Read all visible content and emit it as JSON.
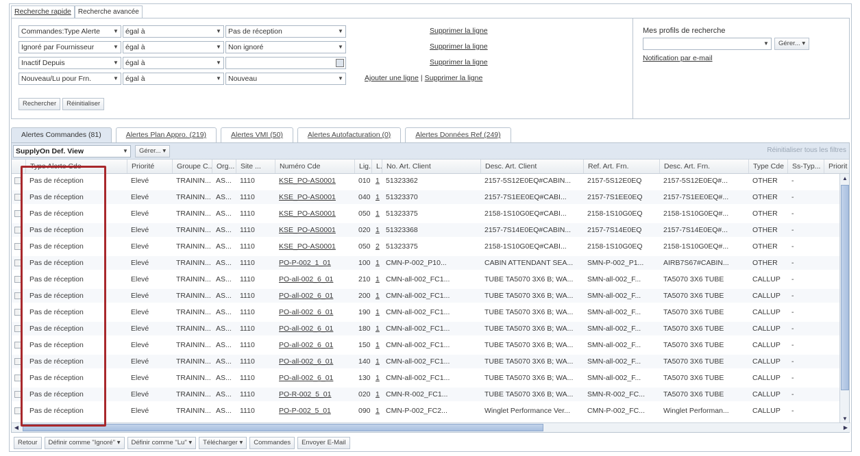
{
  "search_tabs": {
    "quick": "Recherche rapide",
    "advanced": "Recherche avancée"
  },
  "criteria": [
    {
      "field": "Commandes:Type Alerte",
      "op": "égal à",
      "value": "Pas de réception",
      "action": "Supprimer la ligne"
    },
    {
      "field": "Ignoré par Fournisseur",
      "op": "égal à",
      "value": "Non ignoré",
      "action": "Supprimer la ligne"
    },
    {
      "field": "Inactif Depuis",
      "op": "égal à",
      "value": "",
      "action": "Supprimer la ligne"
    },
    {
      "field": "Nouveau/Lu pour Frn.",
      "op": "égal à",
      "value": "Nouveau",
      "add": "Ajouter une ligne",
      "sep": "|",
      "action": "Supprimer la ligne"
    }
  ],
  "buttons": {
    "search": "Rechercher",
    "reset": "Réinitialiser"
  },
  "profiles": {
    "title": "Mes profils de recherche",
    "manage": "Gérer...",
    "notification": "Notification par e-mail"
  },
  "result_tabs": [
    "Alertes Commandes (81)",
    "Alertes Plan Appro. (219)",
    "Alertes VMI (50)",
    "Alertes Autofacturation (0)",
    "Alertes Données Ref (249)"
  ],
  "view": {
    "selected": "SupplyOn Def. View",
    "manage": "Gérer...",
    "reset_filters": "Réinitialiser tous les filtres"
  },
  "columns": [
    "Type Alerte Cde",
    "Priorité",
    "Groupe C...",
    "Org...",
    "Site ...",
    "Numéro Cde",
    "Lig...",
    "L...",
    "No. Art. Client",
    "Desc. Art. Client",
    "Ref. Art. Frn.",
    "Desc. Art. Frn.",
    "Type Cde",
    "Ss-Typ...",
    "Priorit"
  ],
  "rows": [
    [
      "Pas de réception",
      "Elevé",
      "TRAININ...",
      "AS...",
      "1110",
      "KSE_PO-AS0001",
      "010",
      "1",
      "51323362",
      "2157-5S12E0EQ#CABIN...",
      "2157-5S12E0EQ",
      "2157-5S12E0EQ#...",
      "OTHER",
      "-"
    ],
    [
      "Pas de réception",
      "Elevé",
      "TRAININ...",
      "AS...",
      "1110",
      "KSE_PO-AS0001",
      "040",
      "1",
      "51323370",
      "2157-7S1EE0EQ#CABI...",
      "2157-7S1EE0EQ",
      "2157-7S1EE0EQ#...",
      "OTHER",
      "-"
    ],
    [
      "Pas de réception",
      "Elevé",
      "TRAININ...",
      "AS...",
      "1110",
      "KSE_PO-AS0001",
      "050",
      "1",
      "51323375",
      "2158-1S10G0EQ#CABI...",
      "2158-1S10G0EQ",
      "2158-1S10G0EQ#...",
      "OTHER",
      "-"
    ],
    [
      "Pas de réception",
      "Elevé",
      "TRAININ...",
      "AS...",
      "1110",
      "KSE_PO-AS0001",
      "020",
      "1",
      "51323368",
      "2157-7S14E0EQ#CABIN...",
      "2157-7S14E0EQ",
      "2157-7S14E0EQ#...",
      "OTHER",
      "-"
    ],
    [
      "Pas de réception",
      "Elevé",
      "TRAININ...",
      "AS...",
      "1110",
      "KSE_PO-AS0001",
      "050",
      "2",
      "51323375",
      "2158-1S10G0EQ#CABI...",
      "2158-1S10G0EQ",
      "2158-1S10G0EQ#...",
      "OTHER",
      "-"
    ],
    [
      "Pas de réception",
      "Elevé",
      "TRAININ...",
      "AS...",
      "1110",
      "PO-P-002_1_01",
      "100",
      "1",
      "CMN-P-002_P10...",
      "CABIN ATTENDANT SEA...",
      "SMN-P-002_P1...",
      "AIRB7S67#CABIN...",
      "OTHER",
      "-"
    ],
    [
      "Pas de réception",
      "Elevé",
      "TRAININ...",
      "AS...",
      "1110",
      "PO-all-002_6_01",
      "210",
      "1",
      "CMN-all-002_FC1...",
      "TUBE TA5070 3X6 B; WA...",
      "SMN-all-002_F...",
      "TA5070 3X6 TUBE",
      "CALLUP",
      "-"
    ],
    [
      "Pas de réception",
      "Elevé",
      "TRAININ...",
      "AS...",
      "1110",
      "PO-all-002_6_01",
      "200",
      "1",
      "CMN-all-002_FC1...",
      "TUBE TA5070 3X6 B; WA...",
      "SMN-all-002_F...",
      "TA5070 3X6 TUBE",
      "CALLUP",
      "-"
    ],
    [
      "Pas de réception",
      "Elevé",
      "TRAININ...",
      "AS...",
      "1110",
      "PO-all-002_6_01",
      "190",
      "1",
      "CMN-all-002_FC1...",
      "TUBE TA5070 3X6 B; WA...",
      "SMN-all-002_F...",
      "TA5070 3X6 TUBE",
      "CALLUP",
      "-"
    ],
    [
      "Pas de réception",
      "Elevé",
      "TRAININ...",
      "AS...",
      "1110",
      "PO-all-002_6_01",
      "180",
      "1",
      "CMN-all-002_FC1...",
      "TUBE TA5070 3X6 B; WA...",
      "SMN-all-002_F...",
      "TA5070 3X6 TUBE",
      "CALLUP",
      "-"
    ],
    [
      "Pas de réception",
      "Elevé",
      "TRAININ...",
      "AS...",
      "1110",
      "PO-all-002_6_01",
      "150",
      "1",
      "CMN-all-002_FC1...",
      "TUBE TA5070 3X6 B; WA...",
      "SMN-all-002_F...",
      "TA5070 3X6 TUBE",
      "CALLUP",
      "-"
    ],
    [
      "Pas de réception",
      "Elevé",
      "TRAININ...",
      "AS...",
      "1110",
      "PO-all-002_6_01",
      "140",
      "1",
      "CMN-all-002_FC1...",
      "TUBE TA5070 3X6 B; WA...",
      "SMN-all-002_F...",
      "TA5070 3X6 TUBE",
      "CALLUP",
      "-"
    ],
    [
      "Pas de réception",
      "Elevé",
      "TRAININ...",
      "AS...",
      "1110",
      "PO-all-002_6_01",
      "130",
      "1",
      "CMN-all-002_FC1...",
      "TUBE TA5070 3X6 B; WA...",
      "SMN-all-002_F...",
      "TA5070 3X6 TUBE",
      "CALLUP",
      "-"
    ],
    [
      "Pas de réception",
      "Elevé",
      "TRAININ...",
      "AS...",
      "1110",
      "PO-R-002_5_01",
      "020",
      "1",
      "CMN-R-002_FC1...",
      "TUBE TA5070 3X6 B; WA...",
      "SMN-R-002_FC...",
      "TA5070 3X6 TUBE",
      "CALLUP",
      "-"
    ],
    [
      "Pas de réception",
      "Elevé",
      "TRAININ...",
      "AS...",
      "1110",
      "PO-P-002_5_01",
      "090",
      "1",
      "CMN-P-002_FC2...",
      "Winglet Performance Ver...",
      "CMN-P-002_FC...",
      "Winglet Performan...",
      "CALLUP",
      "-"
    ]
  ],
  "footer": [
    "Retour",
    "Définir comme \"Ignoré\"",
    "Définir comme \"Lu\"",
    "Télécharger",
    "Commandes",
    "Envoyer E-Mail"
  ],
  "footer_dropdown": [
    false,
    true,
    true,
    true,
    false,
    false
  ],
  "colors": {
    "highlight": "#a8282c",
    "border": "#b8c3cf",
    "tab_active": "#dfe7f1"
  }
}
